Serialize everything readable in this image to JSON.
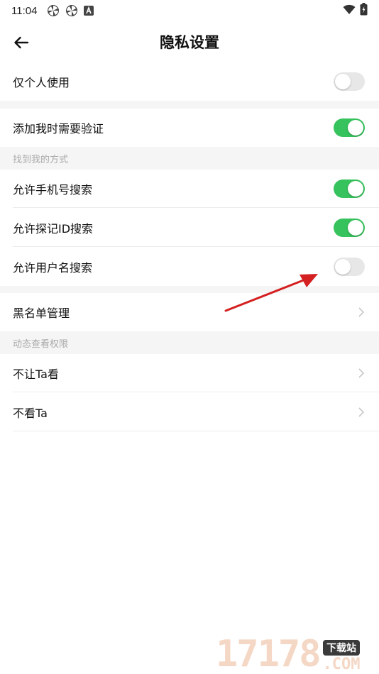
{
  "status_bar": {
    "time": "11:04",
    "icons": [
      "pinwheel-icon",
      "pinwheel-icon",
      "a-badge-icon"
    ],
    "right_icons": [
      "wifi-icon",
      "battery-icon"
    ]
  },
  "header": {
    "title": "隐私设置",
    "back_icon": "back-arrow-icon"
  },
  "settings": {
    "personal_only": {
      "label": "仅个人使用",
      "enabled": false
    },
    "require_verification": {
      "label": "添加我时需要验证",
      "enabled": true
    }
  },
  "find_me": {
    "section_title": "找到我的方式",
    "phone": {
      "label": "允许手机号搜索",
      "enabled": true
    },
    "tanji_id": {
      "label": "允许探记ID搜索",
      "enabled": true
    },
    "username": {
      "label": "允许用户名搜索",
      "enabled": false
    }
  },
  "blacklist": {
    "label": "黑名单管理"
  },
  "moments": {
    "section_title": "动态查看权限",
    "hide_from": {
      "label": "不让Ta看"
    },
    "dont_see": {
      "label": "不看Ta"
    }
  },
  "colors": {
    "toggle_on": "#36c25c",
    "toggle_off": "#e7e7e7",
    "annotation_arrow": "#d42020"
  },
  "watermark": {
    "digits": "17178",
    "badge": "下载站",
    "suffix": ".COM"
  }
}
